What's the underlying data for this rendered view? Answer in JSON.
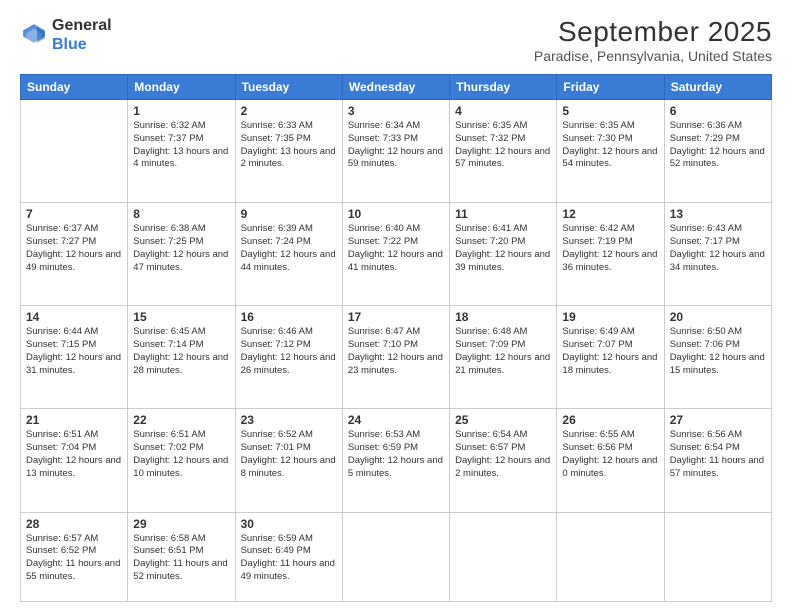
{
  "header": {
    "logo": {
      "line1": "General",
      "line2": "Blue"
    },
    "title": "September 2025",
    "subtitle": "Paradise, Pennsylvania, United States"
  },
  "weekdays": [
    "Sunday",
    "Monday",
    "Tuesday",
    "Wednesday",
    "Thursday",
    "Friday",
    "Saturday"
  ],
  "weeks": [
    [
      {
        "day": "",
        "sunrise": "",
        "sunset": "",
        "daylight": ""
      },
      {
        "day": "1",
        "sunrise": "Sunrise: 6:32 AM",
        "sunset": "Sunset: 7:37 PM",
        "daylight": "Daylight: 13 hours and 4 minutes."
      },
      {
        "day": "2",
        "sunrise": "Sunrise: 6:33 AM",
        "sunset": "Sunset: 7:35 PM",
        "daylight": "Daylight: 13 hours and 2 minutes."
      },
      {
        "day": "3",
        "sunrise": "Sunrise: 6:34 AM",
        "sunset": "Sunset: 7:33 PM",
        "daylight": "Daylight: 12 hours and 59 minutes."
      },
      {
        "day": "4",
        "sunrise": "Sunrise: 6:35 AM",
        "sunset": "Sunset: 7:32 PM",
        "daylight": "Daylight: 12 hours and 57 minutes."
      },
      {
        "day": "5",
        "sunrise": "Sunrise: 6:35 AM",
        "sunset": "Sunset: 7:30 PM",
        "daylight": "Daylight: 12 hours and 54 minutes."
      },
      {
        "day": "6",
        "sunrise": "Sunrise: 6:36 AM",
        "sunset": "Sunset: 7:29 PM",
        "daylight": "Daylight: 12 hours and 52 minutes."
      }
    ],
    [
      {
        "day": "7",
        "sunrise": "Sunrise: 6:37 AM",
        "sunset": "Sunset: 7:27 PM",
        "daylight": "Daylight: 12 hours and 49 minutes."
      },
      {
        "day": "8",
        "sunrise": "Sunrise: 6:38 AM",
        "sunset": "Sunset: 7:25 PM",
        "daylight": "Daylight: 12 hours and 47 minutes."
      },
      {
        "day": "9",
        "sunrise": "Sunrise: 6:39 AM",
        "sunset": "Sunset: 7:24 PM",
        "daylight": "Daylight: 12 hours and 44 minutes."
      },
      {
        "day": "10",
        "sunrise": "Sunrise: 6:40 AM",
        "sunset": "Sunset: 7:22 PM",
        "daylight": "Daylight: 12 hours and 41 minutes."
      },
      {
        "day": "11",
        "sunrise": "Sunrise: 6:41 AM",
        "sunset": "Sunset: 7:20 PM",
        "daylight": "Daylight: 12 hours and 39 minutes."
      },
      {
        "day": "12",
        "sunrise": "Sunrise: 6:42 AM",
        "sunset": "Sunset: 7:19 PM",
        "daylight": "Daylight: 12 hours and 36 minutes."
      },
      {
        "day": "13",
        "sunrise": "Sunrise: 6:43 AM",
        "sunset": "Sunset: 7:17 PM",
        "daylight": "Daylight: 12 hours and 34 minutes."
      }
    ],
    [
      {
        "day": "14",
        "sunrise": "Sunrise: 6:44 AM",
        "sunset": "Sunset: 7:15 PM",
        "daylight": "Daylight: 12 hours and 31 minutes."
      },
      {
        "day": "15",
        "sunrise": "Sunrise: 6:45 AM",
        "sunset": "Sunset: 7:14 PM",
        "daylight": "Daylight: 12 hours and 28 minutes."
      },
      {
        "day": "16",
        "sunrise": "Sunrise: 6:46 AM",
        "sunset": "Sunset: 7:12 PM",
        "daylight": "Daylight: 12 hours and 26 minutes."
      },
      {
        "day": "17",
        "sunrise": "Sunrise: 6:47 AM",
        "sunset": "Sunset: 7:10 PM",
        "daylight": "Daylight: 12 hours and 23 minutes."
      },
      {
        "day": "18",
        "sunrise": "Sunrise: 6:48 AM",
        "sunset": "Sunset: 7:09 PM",
        "daylight": "Daylight: 12 hours and 21 minutes."
      },
      {
        "day": "19",
        "sunrise": "Sunrise: 6:49 AM",
        "sunset": "Sunset: 7:07 PM",
        "daylight": "Daylight: 12 hours and 18 minutes."
      },
      {
        "day": "20",
        "sunrise": "Sunrise: 6:50 AM",
        "sunset": "Sunset: 7:06 PM",
        "daylight": "Daylight: 12 hours and 15 minutes."
      }
    ],
    [
      {
        "day": "21",
        "sunrise": "Sunrise: 6:51 AM",
        "sunset": "Sunset: 7:04 PM",
        "daylight": "Daylight: 12 hours and 13 minutes."
      },
      {
        "day": "22",
        "sunrise": "Sunrise: 6:51 AM",
        "sunset": "Sunset: 7:02 PM",
        "daylight": "Daylight: 12 hours and 10 minutes."
      },
      {
        "day": "23",
        "sunrise": "Sunrise: 6:52 AM",
        "sunset": "Sunset: 7:01 PM",
        "daylight": "Daylight: 12 hours and 8 minutes."
      },
      {
        "day": "24",
        "sunrise": "Sunrise: 6:53 AM",
        "sunset": "Sunset: 6:59 PM",
        "daylight": "Daylight: 12 hours and 5 minutes."
      },
      {
        "day": "25",
        "sunrise": "Sunrise: 6:54 AM",
        "sunset": "Sunset: 6:57 PM",
        "daylight": "Daylight: 12 hours and 2 minutes."
      },
      {
        "day": "26",
        "sunrise": "Sunrise: 6:55 AM",
        "sunset": "Sunset: 6:56 PM",
        "daylight": "Daylight: 12 hours and 0 minutes."
      },
      {
        "day": "27",
        "sunrise": "Sunrise: 6:56 AM",
        "sunset": "Sunset: 6:54 PM",
        "daylight": "Daylight: 11 hours and 57 minutes."
      }
    ],
    [
      {
        "day": "28",
        "sunrise": "Sunrise: 6:57 AM",
        "sunset": "Sunset: 6:52 PM",
        "daylight": "Daylight: 11 hours and 55 minutes."
      },
      {
        "day": "29",
        "sunrise": "Sunrise: 6:58 AM",
        "sunset": "Sunset: 6:51 PM",
        "daylight": "Daylight: 11 hours and 52 minutes."
      },
      {
        "day": "30",
        "sunrise": "Sunrise: 6:59 AM",
        "sunset": "Sunset: 6:49 PM",
        "daylight": "Daylight: 11 hours and 49 minutes."
      },
      {
        "day": "",
        "sunrise": "",
        "sunset": "",
        "daylight": ""
      },
      {
        "day": "",
        "sunrise": "",
        "sunset": "",
        "daylight": ""
      },
      {
        "day": "",
        "sunrise": "",
        "sunset": "",
        "daylight": ""
      },
      {
        "day": "",
        "sunrise": "",
        "sunset": "",
        "daylight": ""
      }
    ]
  ]
}
